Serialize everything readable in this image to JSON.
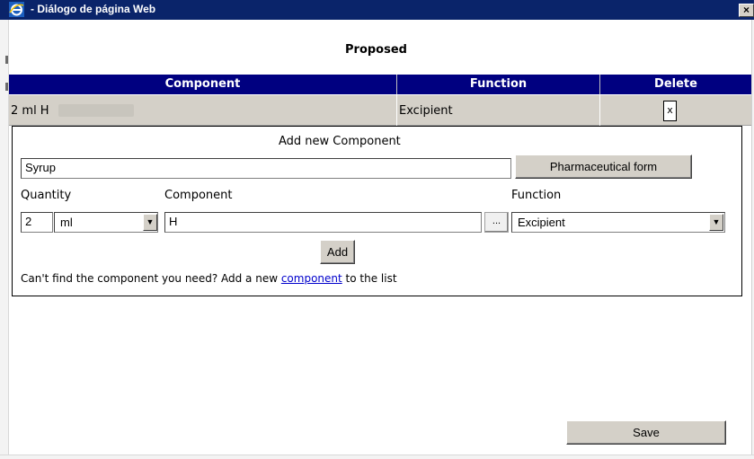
{
  "window": {
    "title": "- Diálogo de página Web",
    "close_glyph": "×"
  },
  "heading": "Proposed",
  "table": {
    "headers": [
      "Component",
      "Function",
      "Delete"
    ],
    "rows": [
      {
        "component": "2 ml H",
        "function": "Excipient",
        "delete_label": "x"
      }
    ]
  },
  "add_panel": {
    "title": "Add new Component",
    "pharmaceutical_form_value": "Syrup",
    "pharmaceutical_form_button": "Pharmaceutical form",
    "quantity_label": "Quantity",
    "component_label": "Component",
    "function_label": "Function",
    "quantity_value": "2",
    "unit_selected": "ml",
    "component_value": "H",
    "browse_label": "...",
    "function_selected": "Excipient",
    "add_button": "Add",
    "help_prefix": "Can't find the component you need? Add a new ",
    "help_link": "component",
    "help_suffix": " to the list"
  },
  "save_button": "Save",
  "icons": {
    "app": "ie-icon",
    "dropdown": "dropdown-arrow-icon",
    "close": "close-icon"
  },
  "colors": {
    "titlebar": "#0a246a",
    "table_header": "#000080",
    "row_bg": "#d4d0c8",
    "link": "#0000cc"
  }
}
